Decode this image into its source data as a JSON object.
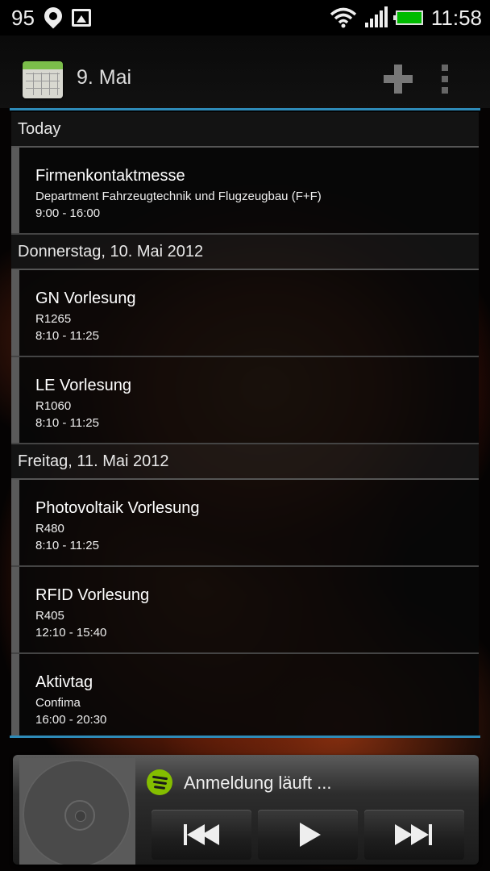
{
  "status_bar": {
    "notification_count": "95",
    "time": "11:58"
  },
  "action_bar": {
    "title": "9. Mai",
    "add_icon": "plus-icon",
    "overflow_icon": "overflow-menu-icon"
  },
  "agenda": {
    "today": {
      "header": "Today",
      "events": [
        {
          "title": "Firmenkontaktmesse",
          "location": "Department Fahrzeugtechnik und Flugzeugbau (F+F)",
          "time": "9:00 - 16:00"
        }
      ]
    },
    "thursday": {
      "header": "Donnerstag, 10. Mai 2012",
      "events": [
        {
          "title": "GN Vorlesung",
          "location": "R1265",
          "time": "8:10 - 11:25"
        },
        {
          "title": "LE Vorlesung",
          "location": "R1060",
          "time": "8:10 - 11:25"
        }
      ]
    },
    "friday": {
      "header": "Freitag, 11. Mai 2012",
      "events": [
        {
          "title": "Photovoltaik Vorlesung",
          "location": "R480",
          "time": "8:10 - 11:25"
        },
        {
          "title": "RFID Vorlesung",
          "location": "R405",
          "time": "12:10 - 15:40"
        },
        {
          "title": "Aktivtag",
          "location": "Confima",
          "time": "16:00 - 20:30"
        }
      ]
    }
  },
  "music_widget": {
    "track": "Anmeldung läuft ...",
    "accent_color": "#84bd00"
  },
  "colors": {
    "divider_blue": "#2e8bb8",
    "battery_green": "#00bb00"
  }
}
